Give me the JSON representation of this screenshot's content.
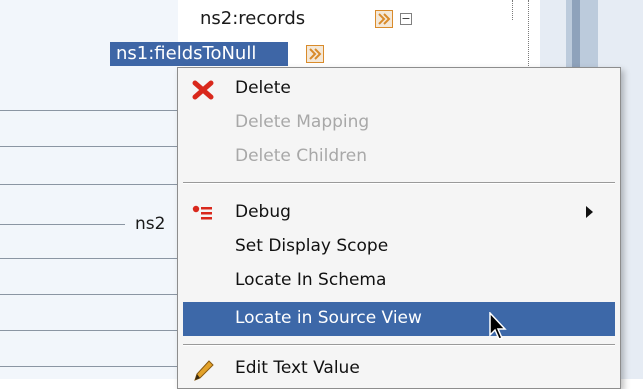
{
  "tree": {
    "records_node": "ns2:records",
    "selected_node": "ns1:fieldsToNull",
    "partial_node": "ns2"
  },
  "context_menu": {
    "items": [
      {
        "label": "Delete",
        "icon": "delete-x-icon",
        "enabled": true
      },
      {
        "label": "Delete Mapping",
        "enabled": false
      },
      {
        "label": "Delete Children",
        "enabled": false
      },
      {
        "label": "Debug",
        "icon": "debug-icon",
        "enabled": true,
        "submenu": true
      },
      {
        "label": "Set Display Scope",
        "enabled": true
      },
      {
        "label": "Locate In Schema",
        "enabled": true
      },
      {
        "label": "Locate in Source View",
        "enabled": true,
        "highlighted": true
      },
      {
        "label": "Edit Text Value",
        "icon": "pencil-icon",
        "enabled": true
      }
    ]
  },
  "colors": {
    "selection": "#3e66a6",
    "menu_highlight": "#3d68a8",
    "delete_icon": "#d9281c",
    "link_icon_border": "#d98b2b"
  }
}
